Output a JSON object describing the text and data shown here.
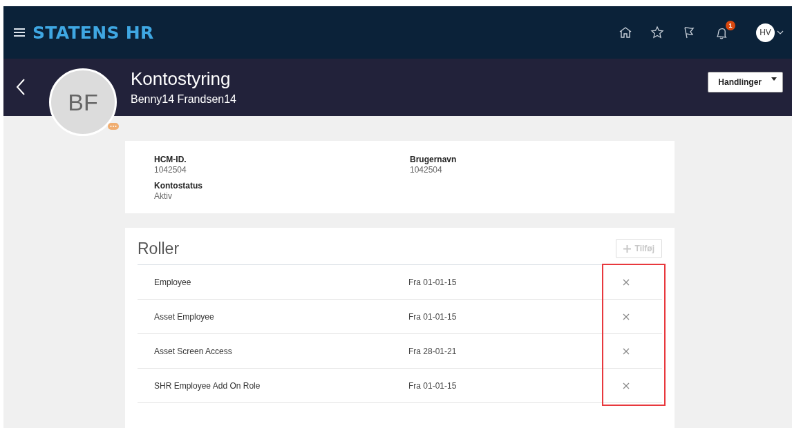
{
  "app": {
    "title": "STATENS HR",
    "notification_count": "1",
    "user_initials": "HV"
  },
  "page": {
    "title": "Kontostyring",
    "subtitle": "Benny14 Frandsen14",
    "avatar_initials": "BF",
    "actions_button": "Handlinger"
  },
  "details": [
    {
      "label": "HCM-ID.",
      "value": "1042504"
    },
    {
      "label": "Brugernavn",
      "value": "1042504"
    },
    {
      "label": "Kontostatus",
      "value": "Aktiv"
    }
  ],
  "roles": {
    "title": "Roller",
    "add_button": {
      "label": "Tilføj",
      "disabled": true
    },
    "highlighted_remove": true,
    "rows": [
      {
        "name": "Employee",
        "from": "Fra 01-01-15"
      },
      {
        "name": "Asset Employee",
        "from": "Fra 01-01-15"
      },
      {
        "name": "Asset Screen Access",
        "from": "Fra 28-01-21"
      },
      {
        "name": "SHR Employee Add On Role",
        "from": "Fra 01-01-15"
      }
    ]
  }
}
